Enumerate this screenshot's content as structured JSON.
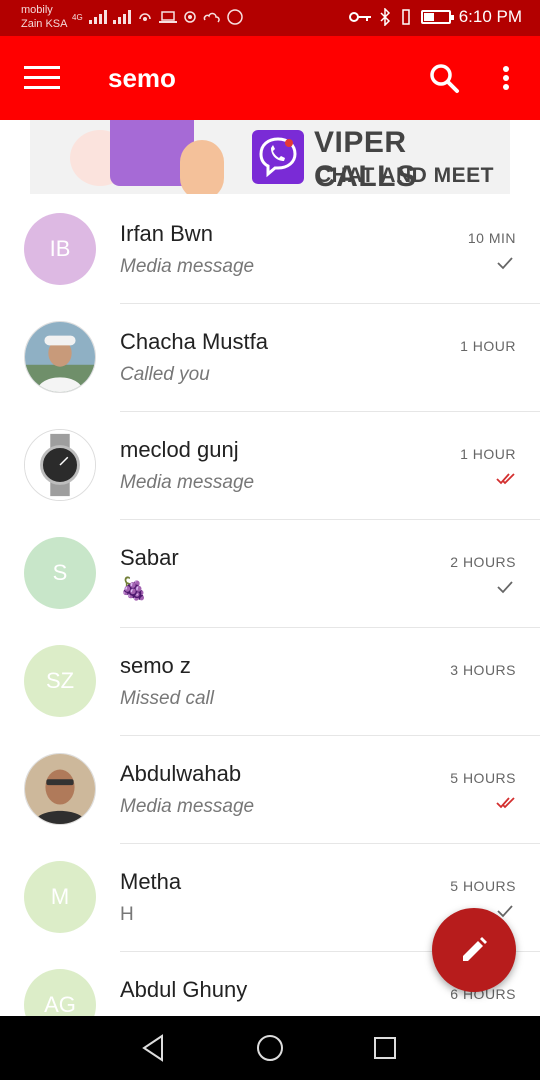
{
  "status_bar": {
    "carrier_line1": "mobily",
    "carrier_line2": "Zain KSA",
    "network_label": "4G",
    "time": "6:10 PM",
    "battery_level": 0.4
  },
  "app_bar": {
    "title": "semo",
    "menu_icon": "hamburger-menu-icon",
    "search_icon": "search-icon",
    "more_icon": "more-vertical-icon"
  },
  "banner": {
    "title": "VIPER CALLS",
    "subtitle": "CHAT AND MEET"
  },
  "chats": [
    {
      "initials": "IB",
      "name": "Irfan Bwn",
      "preview": "Media message",
      "time": "10 MIN",
      "status": "sent",
      "avatar_color": "#ddb9e3"
    },
    {
      "initials": "",
      "name": "Chacha Mustfa",
      "preview": "Called you",
      "time": "1 HOUR",
      "status": "",
      "avatar_color": "#9fb7c9"
    },
    {
      "initials": "",
      "name": "meclod gunj",
      "preview": "Media message",
      "time": "1 HOUR",
      "status": "read",
      "avatar_color": "#d8d8d8"
    },
    {
      "initials": "S",
      "name": "Sabar",
      "preview": "🍇",
      "time": "2 HOURS",
      "status": "sent",
      "avatar_color": "#c8e6c9"
    },
    {
      "initials": "SZ",
      "name": "semo z",
      "preview": "Missed call",
      "time": "3 HOURS",
      "status": "",
      "avatar_color": "#dcedc8"
    },
    {
      "initials": "",
      "name": "Abdulwahab",
      "preview": "Media message",
      "time": "5 HOURS",
      "status": "read",
      "avatar_color": "#c9a27e"
    },
    {
      "initials": "M",
      "name": "Metha",
      "preview": "H",
      "time": "5 HOURS",
      "status": "sent",
      "avatar_color": "#dcedc8"
    },
    {
      "initials": "AG",
      "name": "Abdul Ghuny",
      "preview": "",
      "time": "6 HOURS",
      "status": "",
      "avatar_color": "#dcedc8"
    }
  ],
  "fab": {
    "icon": "pencil-icon"
  },
  "nav": {
    "back_icon": "back-icon",
    "home_icon": "home-icon",
    "recents_icon": "recents-icon"
  }
}
